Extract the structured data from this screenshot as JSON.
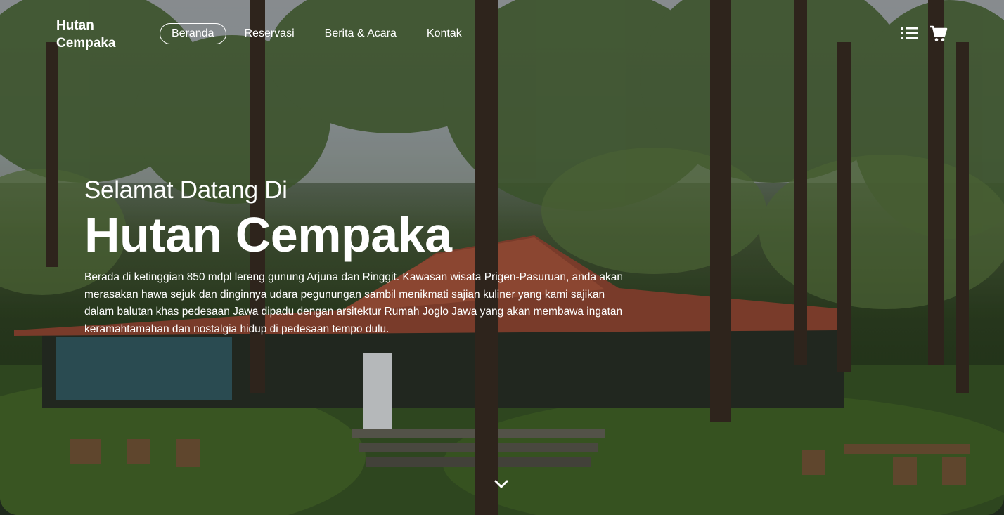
{
  "nav": {
    "logo": "Hutan Cempaka",
    "items": [
      {
        "label": "Beranda",
        "active": true
      },
      {
        "label": "Reservasi",
        "active": false
      },
      {
        "label": "Berita & Acara",
        "active": false
      },
      {
        "label": "Kontak",
        "active": false
      }
    ],
    "icons": [
      "list-icon",
      "cart-icon"
    ]
  },
  "hero": {
    "welcome": "Selamat Datang Di",
    "title": "Hutan Cempaka",
    "description": "Berada di ketinggian 850 mdpl lereng gunung Arjuna dan Ringgit. Kawasan wisata Prigen-Pasuruan, anda akan merasakan hawa sejuk dan dinginnya udara pegunungan sambil menikmati sajian kuliner yang kami sajikan dalam balutan khas pedesaan Jawa dipadu dengan arsitektur Rumah Joglo Jawa yang akan membawa ingatan keramahtamahan dan nostalgia hidup di pedesaan tempo dulu.",
    "scroll_icon": "chevron-down-icon"
  },
  "colors": {
    "text": "#ffffff",
    "roof": "#a0503a",
    "foliage": "#3f5a2e"
  }
}
